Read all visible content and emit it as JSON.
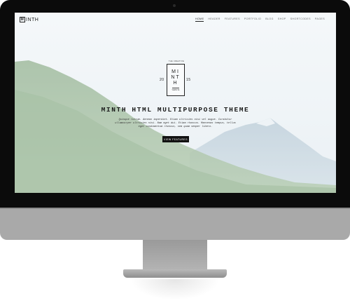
{
  "site": {
    "logo_mark": "M",
    "logo_text": "INTH"
  },
  "nav": {
    "items": [
      {
        "label": "HOME",
        "active": true
      },
      {
        "label": "HEADER",
        "active": false
      },
      {
        "label": "FEATURES",
        "active": false
      },
      {
        "label": "PORTFOLIO",
        "active": false
      },
      {
        "label": "BLOG",
        "active": false
      },
      {
        "label": "SHOP",
        "active": false
      },
      {
        "label": "SHORTCODES",
        "active": false
      },
      {
        "label": "PAGES",
        "active": false
      }
    ]
  },
  "hero": {
    "emblem": {
      "top_text": "THE CREATIVE",
      "letters": "MINTH",
      "bottom_text": "WEBSITE",
      "year_left": "20",
      "year_right": "15"
    },
    "title": "MINTH HTML MULTIPURPOSE THEME",
    "description": "Quisque rutrum. Aenean imperdiet. Etiam ultricies nisi vel augue. Curabitur ullamcorper ultricies nisi. Nam eget dui. Etiam rhoncus. Maecenas tempus, tellus eget condimentum rhoncus, sem quam semper libero.",
    "cta_label": "VIEW FEATURES"
  },
  "colors": {
    "frame": "#0b0b0b",
    "chin": "#a9a9a9",
    "cta_bg": "#111111",
    "sky": "#e6eef2",
    "forest": "#5f8a5a"
  }
}
